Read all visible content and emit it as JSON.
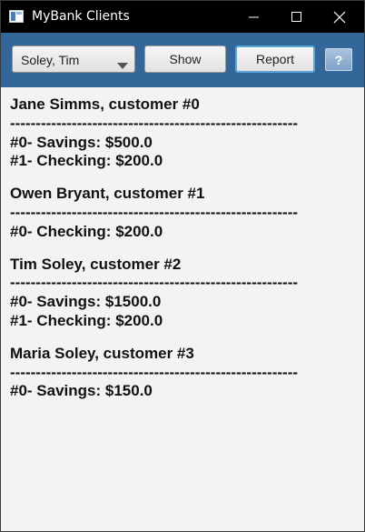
{
  "window": {
    "title": "MyBank Clients"
  },
  "toolbar": {
    "client_select_value": "Soley, Tim",
    "show_label": "Show",
    "report_label": "Report",
    "help_label": "?"
  },
  "report": {
    "customers": [
      {
        "heading": "Jane Simms, customer #0",
        "separator": "--------------------------------------------------------",
        "accounts": [
          "#0- Savings: $500.0",
          "#1- Checking: $200.0"
        ]
      },
      {
        "heading": "Owen Bryant, customer #1",
        "separator": "--------------------------------------------------------",
        "accounts": [
          "#0- Checking: $200.0"
        ]
      },
      {
        "heading": "Tim Soley, customer #2",
        "separator": "--------------------------------------------------------",
        "accounts": [
          "#0- Savings: $1500.0",
          "#1- Checking: $200.0"
        ]
      },
      {
        "heading": "Maria Soley, customer #3",
        "separator": "--------------------------------------------------------",
        "accounts": [
          "#0- Savings: $150.0"
        ]
      }
    ]
  },
  "colors": {
    "titlebar": "#000000",
    "toolbar": "#336699",
    "content_bg": "#f3f3f3",
    "report_focus": "#5aa6d6"
  },
  "icons": {
    "app": "app-window-icon",
    "minimize": "minimize-icon",
    "maximize": "maximize-icon",
    "close": "close-icon",
    "dropdown": "chevron-down-icon"
  }
}
